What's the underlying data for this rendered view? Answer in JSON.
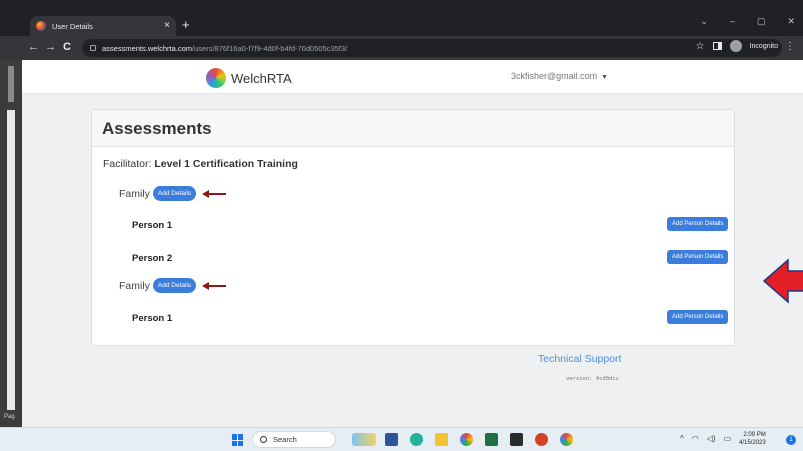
{
  "browser": {
    "tab_title": "User Details",
    "tab_close": "×",
    "new_tab": "+",
    "back": "←",
    "forward": "→",
    "reload": "C",
    "url_host": "assessments.welchrta.com",
    "url_path": "/users/876f16a0-f7f9-4d0f-b4fd-76d0505c35f3/",
    "star": "☆",
    "incognito_label": "Incognito",
    "menu": "⋮",
    "win_min": "–",
    "win_max": "▢",
    "win_close": "✕",
    "win_chevron": "⌄"
  },
  "ruler": {
    "page_label": "Pag"
  },
  "navbar": {
    "brand": "WelchRTA",
    "user_email": "3ckfisher@gmail.com",
    "caret": "▼"
  },
  "assessments": {
    "title": "Assessments",
    "facilitator_prefix": "Facilitator: ",
    "facilitator_name": "Level 1 Certification Training",
    "families": [
      {
        "label": "Family",
        "button": "Add Details",
        "persons": [
          {
            "name": "Person 1",
            "button": "Add Person Details"
          },
          {
            "name": "Person 2",
            "button": "Add Person Details"
          }
        ]
      },
      {
        "label": "Family",
        "button": "Add Details",
        "persons": [
          {
            "name": "Person 1",
            "button": "Add Person Details"
          }
        ]
      }
    ]
  },
  "footer": {
    "support": "Technical Support",
    "version": "version: 4cd0dcc"
  },
  "taskbar": {
    "search": "Search",
    "time": "2:09 PM",
    "date": "4/15/2023",
    "notification_count": "1",
    "tray_chevron": "^"
  },
  "colors": {
    "accent_button": "#3b7ddd",
    "annotation_arrow_dark": "#8b1a1a",
    "annotation_arrow_big": "#e41e26",
    "link": "#4a90d9"
  }
}
